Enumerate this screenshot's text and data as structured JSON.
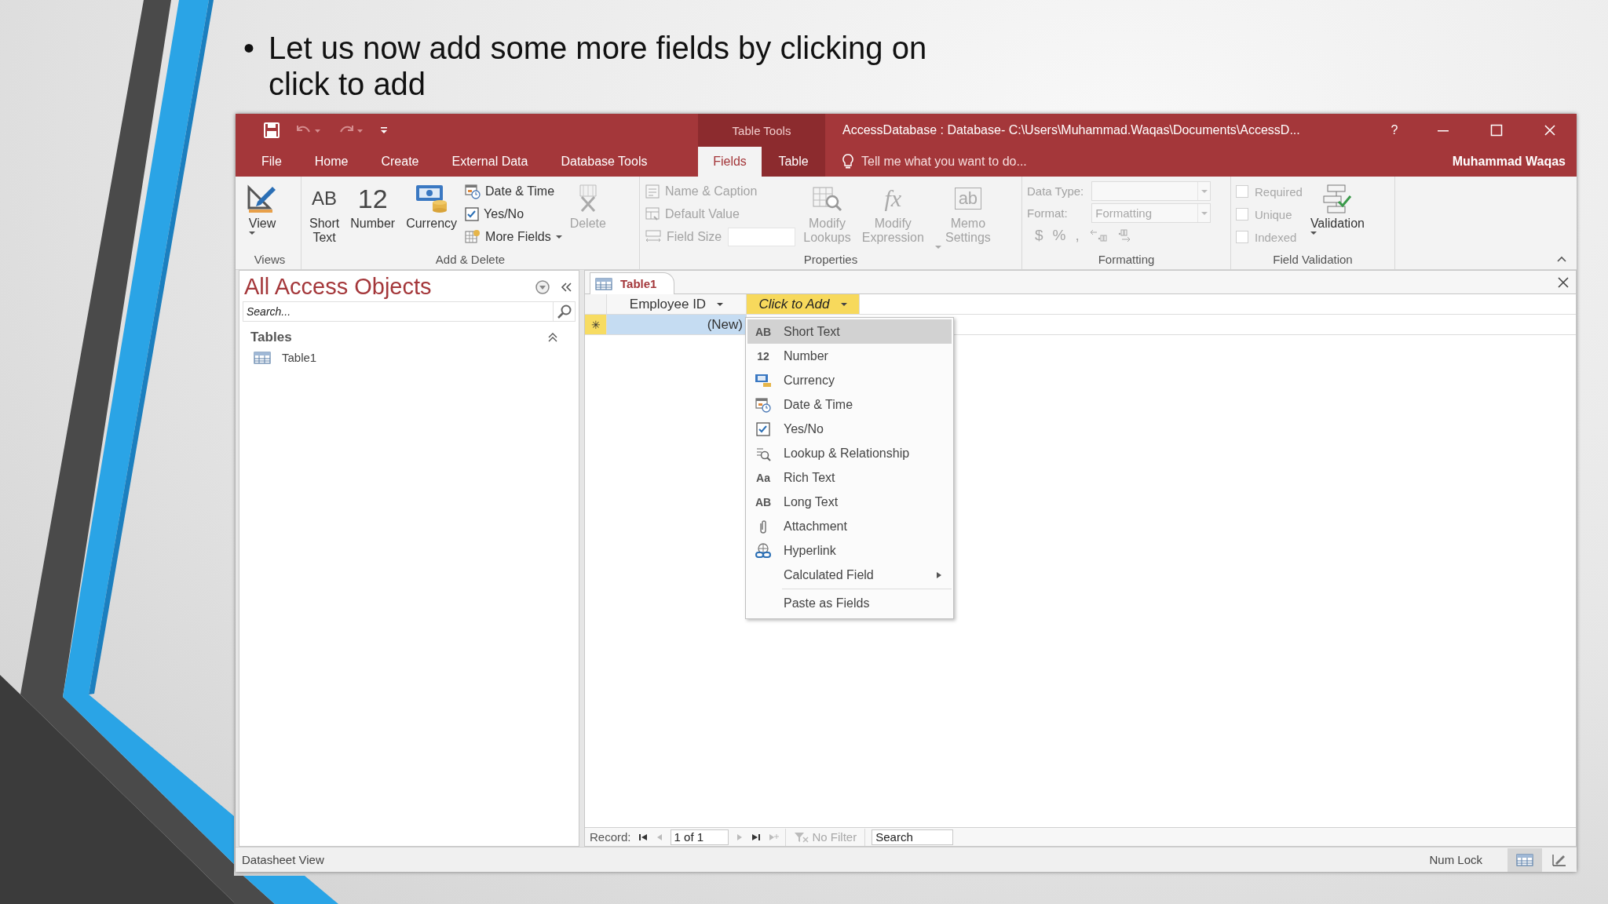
{
  "slide": {
    "bullet_mark": "•",
    "text": "Let us now add some more fields by clicking on click to add"
  },
  "window": {
    "context_group": "Table Tools",
    "title": "AccessDatabase : Database- C:\\Users\\Muhammad.Waqas\\Documents\\AccessD...",
    "help": "?",
    "tabs": [
      {
        "label": "File",
        "selected": false,
        "contextual": false
      },
      {
        "label": "Home",
        "selected": false,
        "contextual": false
      },
      {
        "label": "Create",
        "selected": false,
        "contextual": false
      },
      {
        "label": "External Data",
        "selected": false,
        "contextual": false
      },
      {
        "label": "Database Tools",
        "selected": false,
        "contextual": false
      },
      {
        "label": "Fields",
        "selected": true,
        "contextual": true
      },
      {
        "label": "Table",
        "selected": false,
        "contextual": true
      }
    ],
    "tell_me": {
      "placeholder": "Tell me what you want to do..."
    },
    "user": "Muhammad Waqas"
  },
  "ribbon": {
    "views": {
      "label": "Views",
      "view": {
        "label": "View",
        "disabled": false
      }
    },
    "add_delete": {
      "label": "Add & Delete",
      "short_text": {
        "glyph": "AB",
        "label": "Short Text",
        "disabled": false
      },
      "number": {
        "glyph": "12",
        "label": "Number",
        "disabled": false
      },
      "currency": {
        "label": "Currency",
        "disabled": false
      },
      "date_time": {
        "label": "Date & Time",
        "disabled": false
      },
      "yes_no": {
        "label": "Yes/No",
        "disabled": false
      },
      "more_fields": {
        "label": "More Fields",
        "disabled": false
      },
      "delete": {
        "label": "Delete",
        "disabled": true
      }
    },
    "properties": {
      "label": "Properties",
      "name_caption": {
        "label": "Name & Caption",
        "disabled": true
      },
      "default_value": {
        "label": "Default Value",
        "disabled": true
      },
      "field_size": {
        "label": "Field Size",
        "disabled": true
      },
      "modify_lookups": {
        "label": "Modify Lookups",
        "disabled": true
      },
      "modify_expression": {
        "glyph": "fx",
        "label": "Modify Expression",
        "disabled": true
      },
      "memo_settings": {
        "glyph": "ab",
        "label": "Memo Settings",
        "disabled": true
      }
    },
    "formatting": {
      "label": "Formatting",
      "data_type": {
        "label": "Data Type:",
        "disabled": true
      },
      "format": {
        "label": "Format:",
        "value": "Formatting",
        "disabled": true
      },
      "symbols": [
        "$",
        "%",
        ","
      ],
      "disabled": true
    },
    "field_validation": {
      "label": "Field Validation",
      "checks": [
        {
          "label": "Required",
          "checked": false,
          "disabled": true
        },
        {
          "label": "Unique",
          "checked": false,
          "disabled": true
        },
        {
          "label": "Indexed",
          "checked": false,
          "disabled": true
        }
      ],
      "validation": {
        "label": "Validation",
        "disabled": false
      }
    }
  },
  "nav_pane": {
    "title": "All Access Objects",
    "search": {
      "placeholder": "Search..."
    },
    "groups": [
      {
        "label": "Tables",
        "expanded": true,
        "items": [
          {
            "label": "Table1",
            "selected": false
          }
        ]
      }
    ]
  },
  "document": {
    "tabs": [
      {
        "label": "Table1",
        "selected": true
      }
    ],
    "columns": [
      {
        "label": "Employee ID",
        "selected": false
      },
      {
        "label": "Click to Add",
        "selected": true
      }
    ],
    "rows": [
      {
        "marker": "✳",
        "cells": [
          "(New)"
        ],
        "selected": true
      }
    ]
  },
  "field_menu": {
    "sections": [
      {
        "items": [
          {
            "kind": "glyph",
            "glyph": "AB",
            "label": "Short Text",
            "selected": true
          },
          {
            "kind": "glyph",
            "glyph": "12",
            "label": "Number",
            "selected": false
          },
          {
            "kind": "currency",
            "label": "Currency",
            "selected": false
          },
          {
            "kind": "datetime",
            "label": "Date & Time",
            "selected": false
          },
          {
            "kind": "checkbox",
            "label": "Yes/No",
            "selected": false
          },
          {
            "kind": "lookup",
            "label": "Lookup & Relationship",
            "selected": false
          },
          {
            "kind": "glyph",
            "glyph": "Aa",
            "label": "Rich Text",
            "selected": false
          },
          {
            "kind": "glyph",
            "glyph": "AB",
            "label": "Long Text",
            "selected": false
          },
          {
            "kind": "attachment",
            "label": "Attachment",
            "selected": false
          },
          {
            "kind": "hyperlink",
            "label": "Hyperlink",
            "selected": false
          },
          {
            "kind": "submenu",
            "label": "Calculated Field",
            "selected": false
          }
        ]
      },
      {
        "items": [
          {
            "kind": "plain",
            "label": "Paste as Fields",
            "selected": false
          }
        ]
      }
    ]
  },
  "record_nav": {
    "label": "Record:",
    "position": "1 of 1",
    "filter": {
      "label": "No Filter",
      "disabled": true
    },
    "search": {
      "placeholder": "Search"
    }
  },
  "status_bar": {
    "text": "Datasheet View",
    "indicators": [
      "Num Lock"
    ],
    "views": [
      {
        "selected": true
      },
      {
        "selected": false
      }
    ]
  }
}
